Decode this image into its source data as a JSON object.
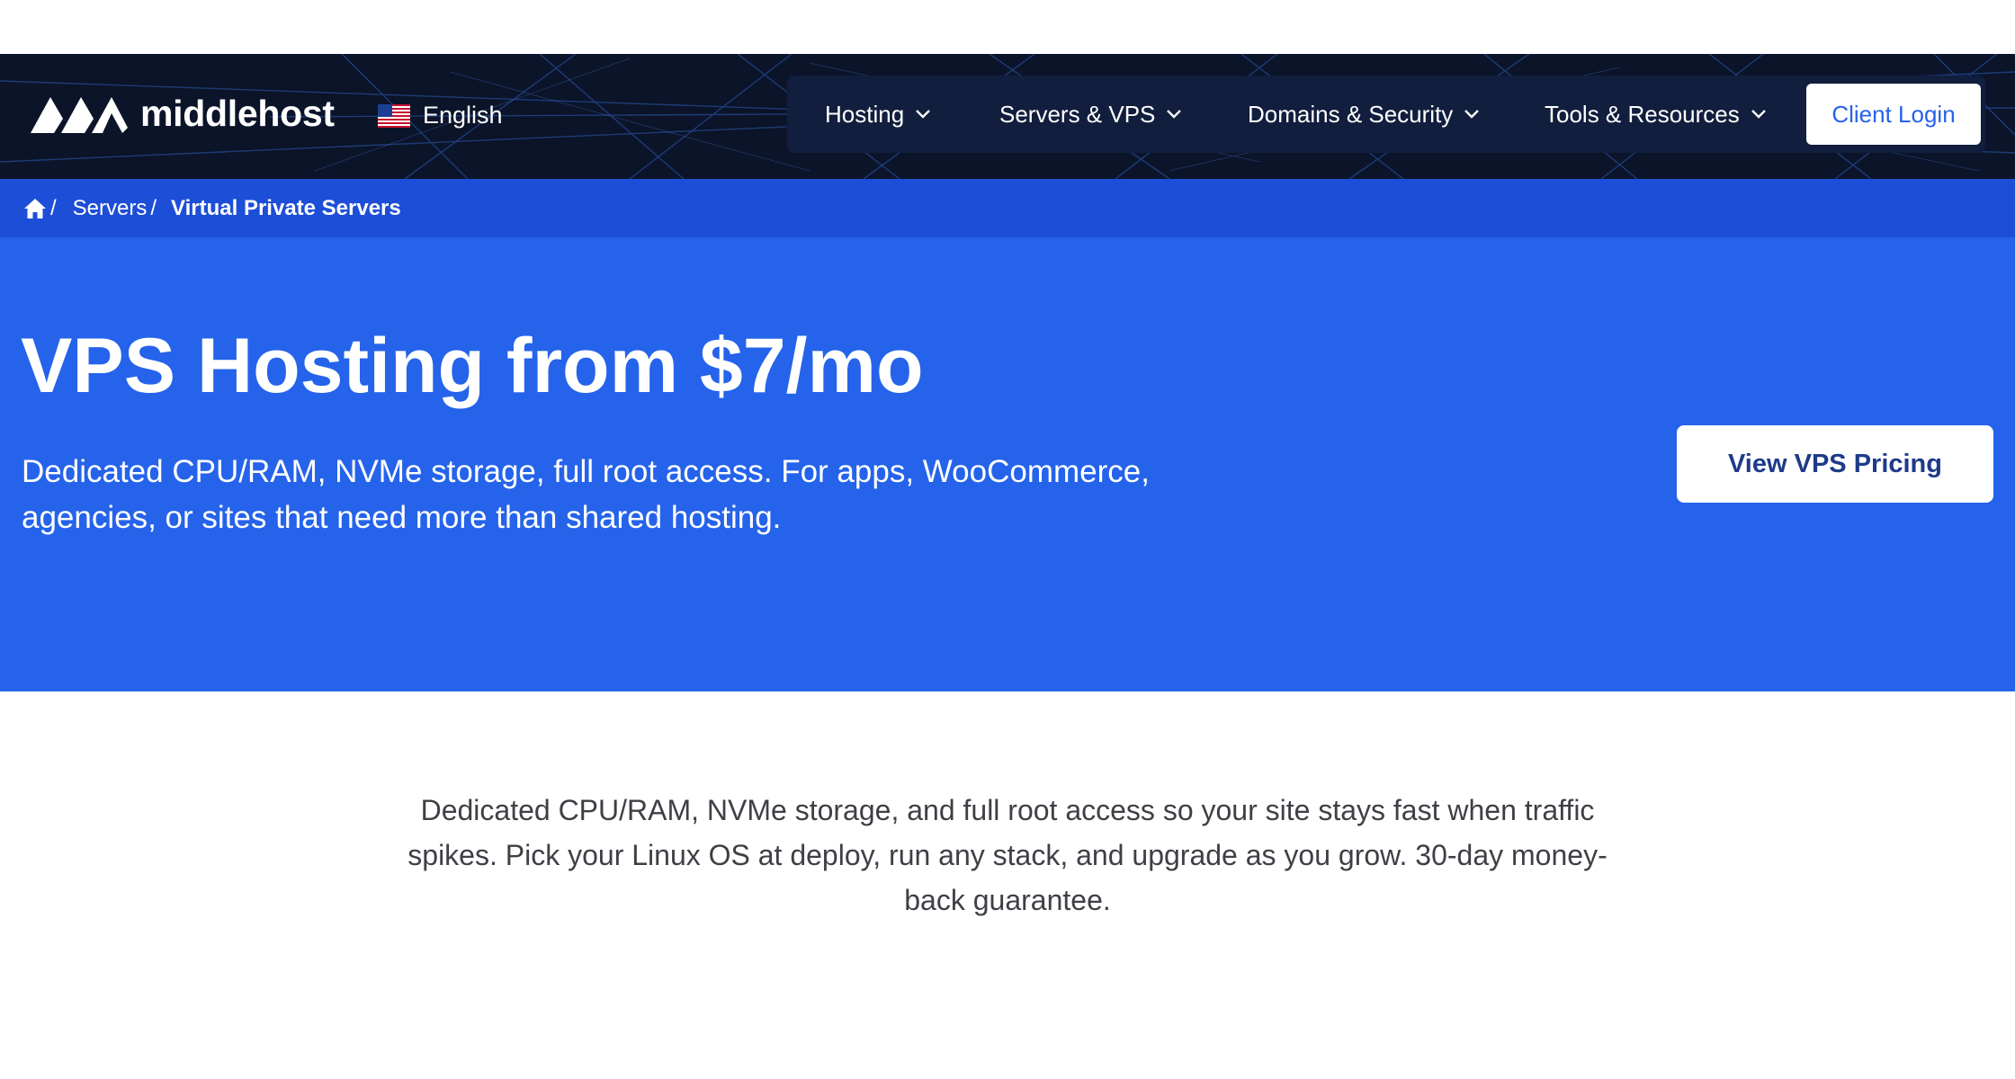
{
  "brand": {
    "name": "middlehost"
  },
  "language": {
    "label": "English"
  },
  "nav": {
    "items": [
      {
        "label": "Hosting"
      },
      {
        "label": "Servers & VPS"
      },
      {
        "label": "Domains & Security"
      },
      {
        "label": "Tools & Resources"
      }
    ],
    "login_label": "Client Login"
  },
  "breadcrumb": {
    "sep": "/",
    "items": [
      "Servers"
    ],
    "current": "Virtual Private Servers"
  },
  "hero": {
    "title": "VPS Hosting from $7/mo",
    "subtitle": "Dedicated CPU/RAM, NVMe storage, full root access. For apps, WooCommerce, agencies, or sites that need more than shared hosting.",
    "cta_label": "View VPS Pricing"
  },
  "intro": {
    "text": "Dedicated CPU/RAM, NVMe storage, and full root access so your site stays fast when traffic spikes. Pick your Linux OS at deploy, run any stack, and upgrade as you grow. 30-day money-back guarantee."
  },
  "colors": {
    "header_bg": "#0b1429",
    "breadcrumb_bg": "#1d4ed8",
    "hero_bg": "#2563eb",
    "accent": "#2563eb"
  },
  "icons": {
    "logo": "middlehost-logo-icon",
    "flag": "us-flag-icon",
    "chevron": "chevron-down-icon",
    "home": "home-icon"
  }
}
